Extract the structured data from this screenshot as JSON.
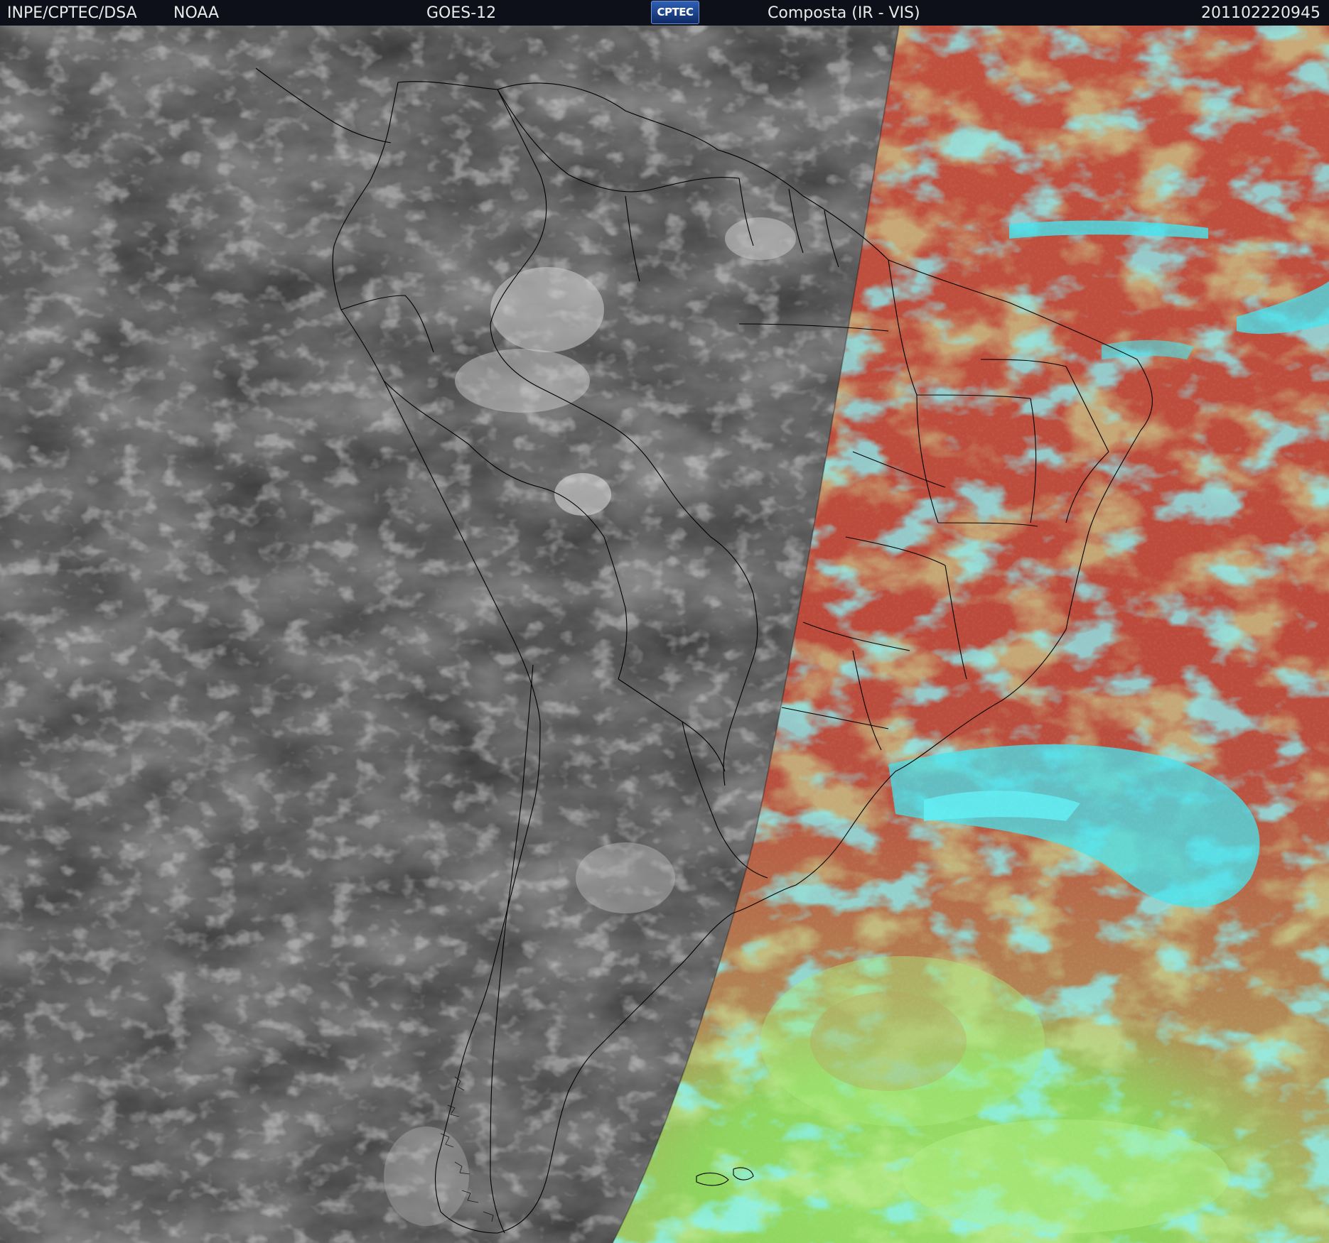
{
  "header": {
    "organization": "INPE/CPTEC/DSA",
    "agency": "NOAA",
    "satellite": "GOES-12",
    "logo_text": "CPTEC",
    "product": "Composta (IR - VIS)",
    "timestamp": "201102220945"
  },
  "map": {
    "region": "South America",
    "night_side_style": "grayscale infrared",
    "day_side_style": "false-color composite",
    "colors": {
      "night_background": "#2f2f2f",
      "day_land_ocean": "#b8473a",
      "day_low_cloud": "#8fe05a",
      "day_high_cloud": "#3fe6f2",
      "boundary_lines": "#000000",
      "header_background": "#0d1018",
      "header_text": "#eaeaea"
    }
  }
}
